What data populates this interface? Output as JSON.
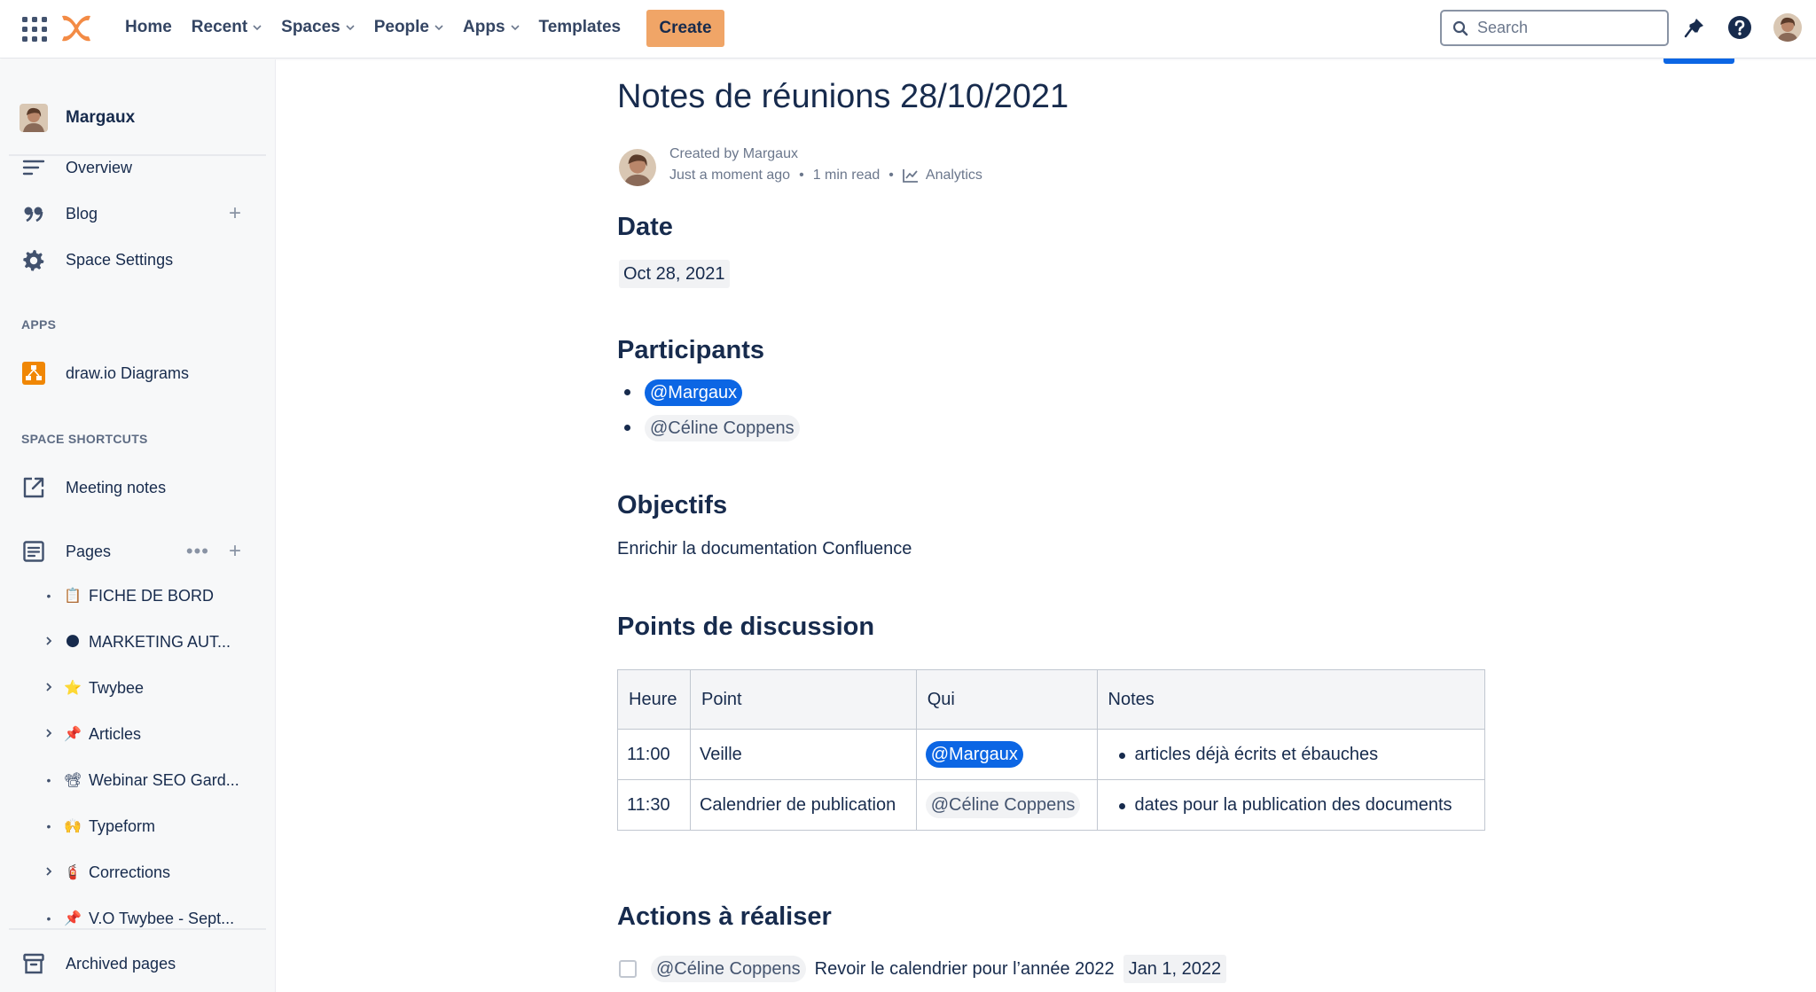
{
  "topbar": {
    "nav": [
      {
        "label": "Home",
        "dropdown": false
      },
      {
        "label": "Recent",
        "dropdown": true
      },
      {
        "label": "Spaces",
        "dropdown": true
      },
      {
        "label": "People",
        "dropdown": true
      },
      {
        "label": "Apps",
        "dropdown": true
      },
      {
        "label": "Templates",
        "dropdown": false
      }
    ],
    "create_label": "Create",
    "search_placeholder": "Search",
    "icons": [
      "app-switcher-icon",
      "confluence-logo",
      "search-icon",
      "notifications-icon",
      "help-icon",
      "user-avatar"
    ]
  },
  "sidebar": {
    "space_name": "Margaux",
    "items": [
      {
        "label": "Overview",
        "icon": "overview-icon"
      },
      {
        "label": "Blog",
        "icon": "blog-quote-icon"
      },
      {
        "label": "Space Settings",
        "icon": "gear-icon"
      }
    ],
    "apps_heading": "APPS",
    "apps": [
      {
        "label": "draw.io Diagrams",
        "icon": "drawio-icon"
      }
    ],
    "shortcuts_heading": "SPACE SHORTCUTS",
    "shortcuts": [
      {
        "label": "Meeting notes",
        "icon": "external-link-icon"
      }
    ],
    "pages_label": "Pages",
    "pages": [
      {
        "label": "FICHE DE BORD",
        "emoji": "📋",
        "expandable": false
      },
      {
        "label": "MARKETING AUT...",
        "emoji": "🌑",
        "expandable": true
      },
      {
        "label": "Twybee",
        "emoji": "⭐",
        "expandable": true
      },
      {
        "label": "Articles",
        "emoji": "📌",
        "expandable": true
      },
      {
        "label": "Webinar SEO Gard...",
        "emoji": "📽",
        "expandable": false
      },
      {
        "label": "Typeform",
        "emoji": "🙌",
        "expandable": false
      },
      {
        "label": "Corrections",
        "emoji": "🧯",
        "expandable": true
      },
      {
        "label": "V.O Twybee - Sept...",
        "emoji": "📌",
        "expandable": false
      }
    ],
    "archived_label": "Archived pages"
  },
  "page": {
    "title": "Notes de réunions 28/10/2021",
    "created_by": "Created by Margaux",
    "time": "Just a moment ago",
    "read_time": "1 min read",
    "analytics_label": "Analytics",
    "date_heading": "Date",
    "date_value": "Oct 28, 2021",
    "participants_heading": "Participants",
    "participants": [
      "@Margaux",
      "@Céline Coppens"
    ],
    "objectives_heading": "Objectifs",
    "objectives_text": "Enrichir la documentation Confluence",
    "discussion_heading": "Points de discussion",
    "table": {
      "headers": [
        "Heure",
        "Point",
        "Qui",
        "Notes"
      ],
      "rows": [
        {
          "time": "11:00",
          "point": "Veille",
          "who": "@Margaux",
          "note": "articles déjà écrits et ébauches"
        },
        {
          "time": "11:30",
          "point": "Calendrier de publication",
          "who": "@Céline Coppens",
          "note": "dates pour la publication des documents"
        }
      ]
    },
    "actions_heading": "Actions à réaliser",
    "action": {
      "assignee": "@Céline Coppens",
      "text": "Revoir le calendrier pour l’année 2022",
      "due": "Jan 1, 2022",
      "done": false
    }
  },
  "colors": {
    "accent": "#0c66e4",
    "create_button": "#f0a567",
    "logo": "#f38b45"
  }
}
